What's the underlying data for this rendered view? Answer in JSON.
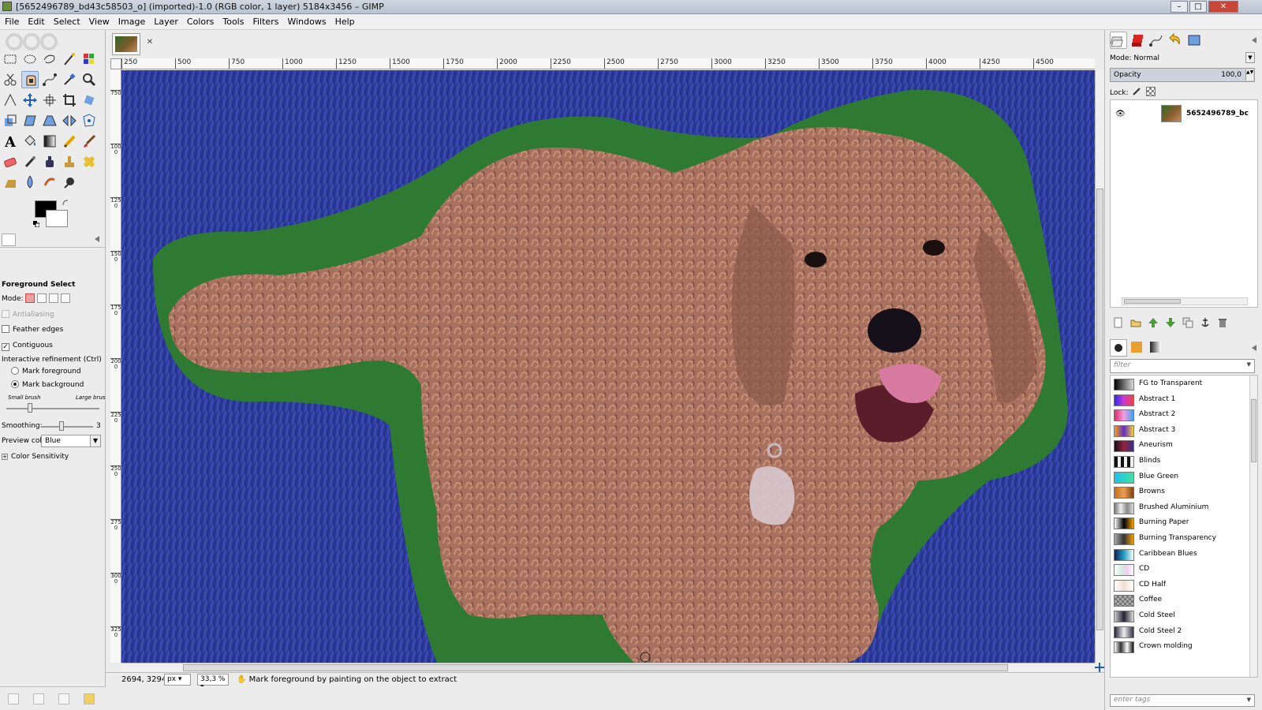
{
  "window": {
    "title": "[5652496789_bd43c58503_o] (imported)-1.0 (RGB color, 1 layer) 5184x3456 – GIMP",
    "controls": {
      "minimize": "–",
      "maximize": "□",
      "close": "✕"
    }
  },
  "menu": [
    "File",
    "Edit",
    "Select",
    "View",
    "Image",
    "Layer",
    "Colors",
    "Tools",
    "Filters",
    "Windows",
    "Help"
  ],
  "image_tab": {
    "close_glyph": "✕"
  },
  "ruler": {
    "h_ticks": [
      "250",
      "500",
      "750",
      "1000",
      "1250",
      "1500",
      "1750",
      "2000",
      "2250",
      "2500",
      "2750",
      "3000",
      "3250",
      "3500",
      "3750",
      "4000",
      "4250",
      "4500"
    ],
    "v_ticks": [
      "750",
      "1000",
      "1250",
      "1500",
      "1750",
      "2000",
      "2250",
      "2500",
      "2750",
      "3000",
      "3250"
    ]
  },
  "tool_options": {
    "title": "Foreground Select",
    "mode_label": "Mode:",
    "antialiasing": "Antialiasing",
    "feather_edges": "Feather edges",
    "contiguous": "Contiguous",
    "interactive_refinement": "Interactive refinement  (Ctrl)",
    "mark_foreground": "Mark foreground",
    "mark_background": "Mark background",
    "small_brush": "Small brush",
    "large_brush": "Large brush",
    "smoothing_label": "Smoothing:",
    "smoothing_value": "3",
    "preview_color_label": "Preview color:",
    "preview_color_value": "Blue",
    "color_sensitivity": "Color Sensitivity",
    "selected_refinement": "Mark background",
    "contiguous_checked": true
  },
  "status": {
    "coords": "2694, 3294",
    "unit": "px",
    "zoom": "33,3 %",
    "message": "Mark foreground by painting on the object to extract"
  },
  "layers": {
    "mode_label": "Mode: Normal",
    "opacity_label": "Opacity",
    "opacity_value": "100,0",
    "lock_label": "Lock:",
    "layer_name": "5652496789_bc"
  },
  "gradients": {
    "filter_placeholder": "filter",
    "tags_placeholder": "enter tags",
    "items": [
      "FG to Transparent",
      "Abstract 1",
      "Abstract 2",
      "Abstract 3",
      "Aneurism",
      "Blinds",
      "Blue Green",
      "Browns",
      "Brushed Aluminium",
      "Burning Paper",
      "Burning Transparency",
      "Caribbean Blues",
      "CD",
      "CD Half",
      "Coffee",
      "Cold Steel",
      "Cold Steel 2",
      "Crown molding"
    ]
  },
  "colors": {
    "foreground": "#000000",
    "background": "#ffffff",
    "preview_overlay": "#2a3fb8",
    "foreground_mark": "#2f8a2a",
    "dog_fur": "#b07a64"
  }
}
